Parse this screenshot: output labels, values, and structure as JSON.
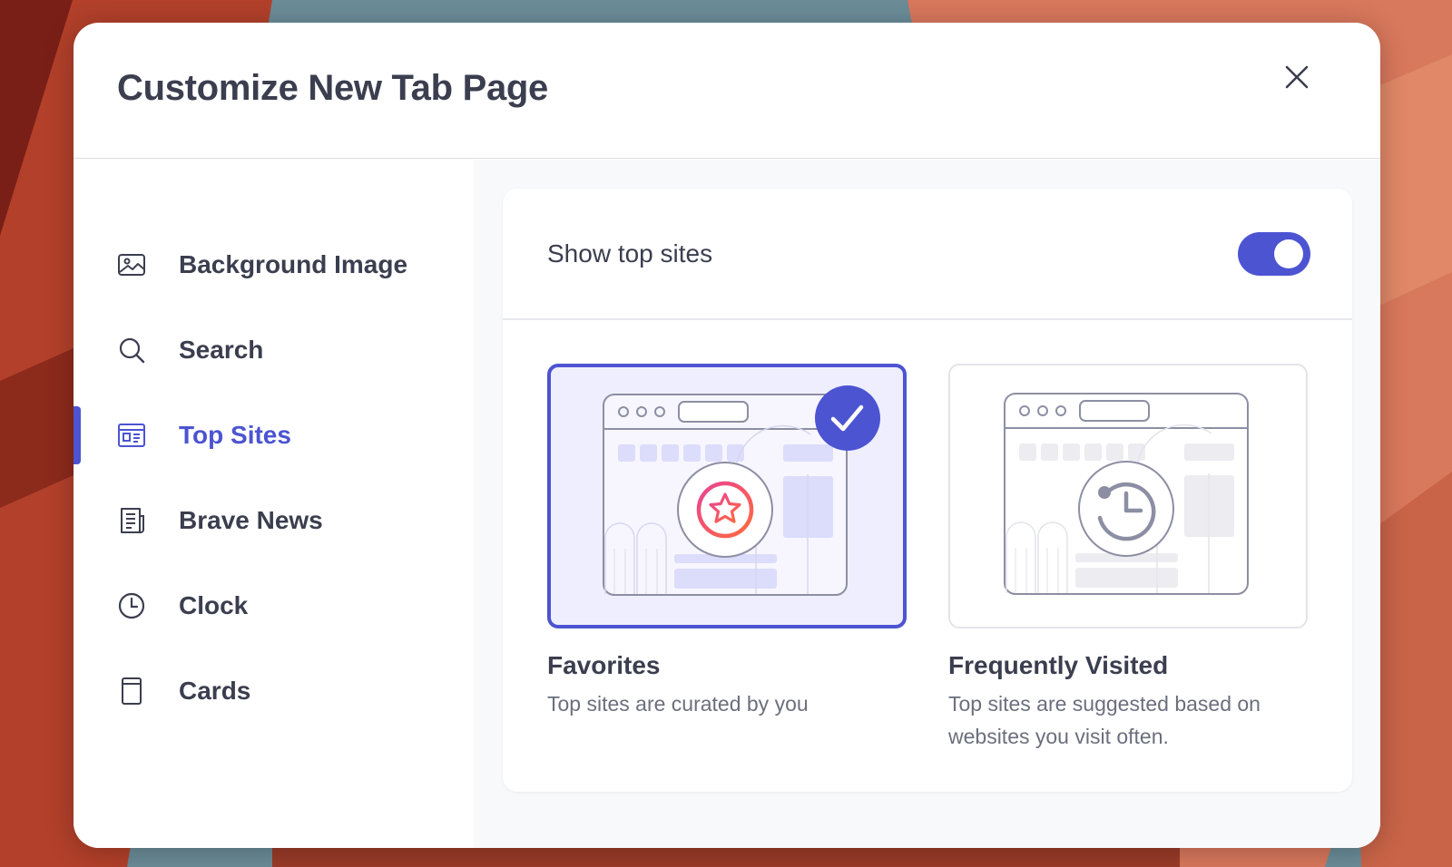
{
  "modal": {
    "title": "Customize New Tab Page",
    "close_icon": "close-icon"
  },
  "sidebar": {
    "items": [
      {
        "label": "Background Image",
        "icon": "image-icon",
        "active": false
      },
      {
        "label": "Search",
        "icon": "search-icon",
        "active": false
      },
      {
        "label": "Top Sites",
        "icon": "top-sites-icon",
        "active": true
      },
      {
        "label": "Brave News",
        "icon": "news-icon",
        "active": false
      },
      {
        "label": "Clock",
        "icon": "clock-icon",
        "active": false
      },
      {
        "label": "Cards",
        "icon": "cards-icon",
        "active": false
      }
    ]
  },
  "settings": {
    "show_top_sites_label": "Show top sites",
    "show_top_sites_enabled": true,
    "options": [
      {
        "title": "Favorites",
        "description": "Top sites are curated by you",
        "selected": true,
        "icon": "star-icon"
      },
      {
        "title": "Frequently Visited",
        "description": "Top sites are suggested based on websites you visit often.",
        "selected": false,
        "icon": "history-icon"
      }
    ]
  },
  "colors": {
    "accent": "#4c54d2",
    "text_primary": "#3b3e4f",
    "text_secondary": "#6b6f7d",
    "selected_bg": "#efeefe"
  }
}
